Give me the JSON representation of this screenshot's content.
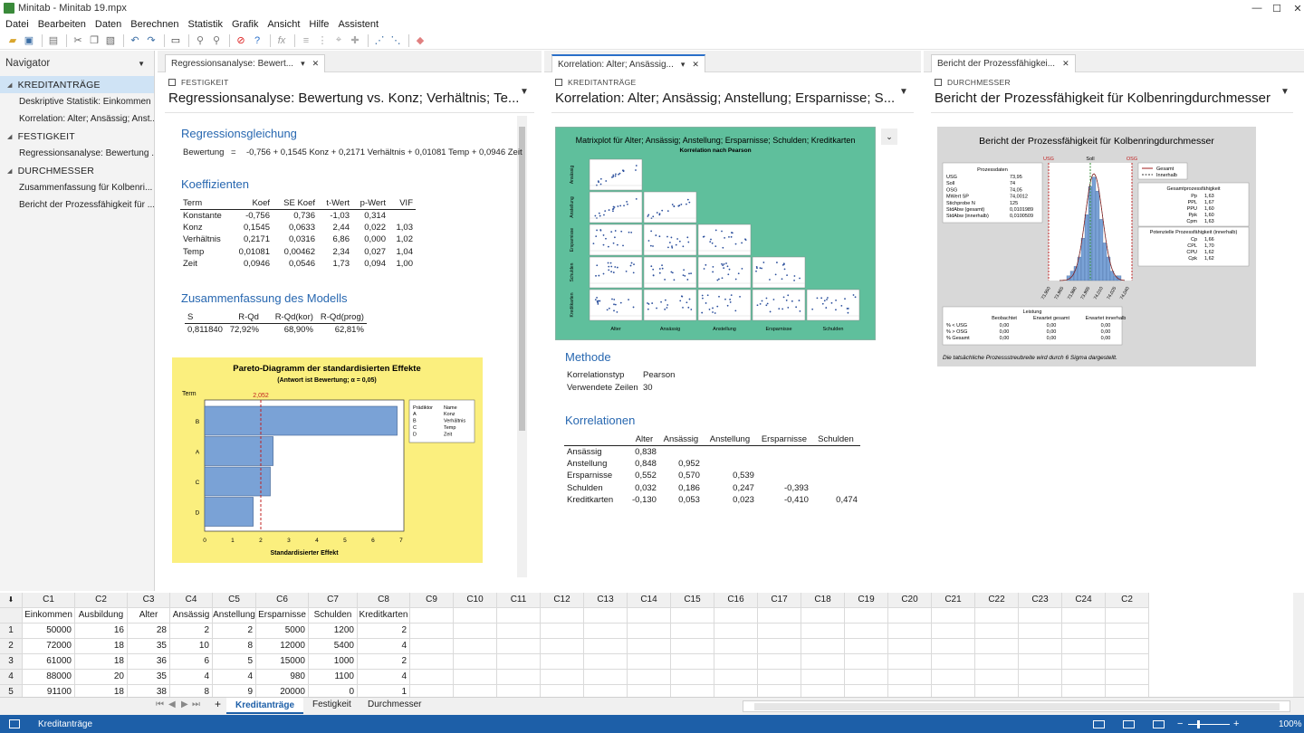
{
  "window": {
    "title": "Minitab - Minitab 19.mpx",
    "minimize": "—",
    "maximize": "☐",
    "close": "✕"
  },
  "menu": [
    "Datei",
    "Bearbeiten",
    "Daten",
    "Berechnen",
    "Statistik",
    "Grafik",
    "Ansicht",
    "Hilfe",
    "Assistent"
  ],
  "navigator": {
    "title": "Navigator",
    "groups": [
      {
        "label": "KREDITANTRÄGE",
        "items": [
          "Deskriptive Statistik: Einkommen",
          "Korrelation: Alter; Ansässig; Anst..."
        ]
      },
      {
        "label": "FESTIGKEIT",
        "items": [
          "Regressionsanalyse: Bewertung ..."
        ]
      },
      {
        "label": "DURCHMESSER",
        "items": [
          "Zusammenfassung für Kolbenri...",
          "Bericht der Prozessfähigkeit für ..."
        ]
      }
    ]
  },
  "pane1": {
    "tab": "Regressionsanalyse: Bewert...",
    "section": "FESTIGKEIT",
    "title": "Regressionsanalyse: Bewertung vs. Konz; Verhältnis; Te...",
    "h_equation": "Regressionsgleichung",
    "eq_lhs": "Bewertung",
    "eq_sign": "=",
    "eq_rhs": "-0,756 + 0,1545 Konz + 0,2171 Verhältnis + 0,01081 Temp + 0,0946 Zeit",
    "h_coef": "Koeffizienten",
    "coef_headers": [
      "Term",
      "Koef",
      "SE Koef",
      "t-Wert",
      "p-Wert",
      "VIF"
    ],
    "coef_rows": [
      [
        "Konstante",
        "-0,756",
        "0,736",
        "-1,03",
        "0,314",
        ""
      ],
      [
        "Konz",
        "0,1545",
        "0,0633",
        "2,44",
        "0,022",
        "1,03"
      ],
      [
        "Verhältnis",
        "0,2171",
        "0,0316",
        "6,86",
        "0,000",
        "1,02"
      ],
      [
        "Temp",
        "0,01081",
        "0,00462",
        "2,34",
        "0,027",
        "1,04"
      ],
      [
        "Zeit",
        "0,0946",
        "0,0546",
        "1,73",
        "0,094",
        "1,00"
      ]
    ],
    "h_model": "Zusammenfassung des Modells",
    "model_headers": [
      "S",
      "R-Qd",
      "R-Qd(kor)",
      "R-Qd(prog)"
    ],
    "model_row": [
      "0,811840",
      "72,92%",
      "68,90%",
      "62,81%"
    ],
    "pareto": {
      "title": "Pareto-Diagramm der standardisierten Effekte",
      "subtitle": "(Antwort ist Bewertung; α = 0,05)",
      "yaxis_label": "Term",
      "ref_label": "2,052",
      "xlabel": "Standardisierter Effekt",
      "legend_headers": [
        "Prädiktor",
        "Name"
      ],
      "legend": [
        [
          "A",
          "Konz"
        ],
        [
          "B",
          "Verhältnis"
        ],
        [
          "C",
          "Temp"
        ],
        [
          "D",
          "Zeit"
        ]
      ],
      "xticks": [
        "0",
        "1",
        "2",
        "3",
        "4",
        "5",
        "6",
        "7"
      ],
      "bg_color": "#fbef7e",
      "bar_color": "#7aa2d6"
    }
  },
  "pane2": {
    "tab": "Korrelation: Alter; Ansässig...",
    "section": "KREDITANTRÄGE",
    "title": "Korrelation: Alter; Ansässig; Anstellung; Ersparnisse; S...",
    "matrix_title": "Matrixplot für Alter; Ansässig; Anstellung; Ersparnisse; Schulden; Kreditkarten",
    "matrix_subtitle": "Korrelation nach Pearson",
    "matrix_vars": [
      "Alter",
      "Ansässig",
      "Anstellung",
      "Ersparnisse",
      "Schulden",
      "Kreditkarten"
    ],
    "matrix_bg": "#5fbf9c",
    "h_method": "Methode",
    "method_rows": [
      [
        "Korrelationstyp",
        "Pearson"
      ],
      [
        "Verwendete Zeilen",
        "30"
      ]
    ],
    "h_corr": "Korrelationen",
    "corr_headers": [
      "",
      "Alter",
      "Ansässig",
      "Anstellung",
      "Ersparnisse",
      "Schulden"
    ],
    "corr_rows": [
      [
        "Ansässig",
        "0,838",
        "",
        "",
        "",
        ""
      ],
      [
        "Anstellung",
        "0,848",
        "0,952",
        "",
        "",
        ""
      ],
      [
        "Ersparnisse",
        "0,552",
        "0,570",
        "0,539",
        "",
        ""
      ],
      [
        "Schulden",
        "0,032",
        "0,186",
        "0,247",
        "-0,393",
        ""
      ],
      [
        "Kreditkarten",
        "-0,130",
        "0,053",
        "0,023",
        "-0,410",
        "0,474"
      ]
    ]
  },
  "pane3": {
    "tab": "Bericht der Prozessfähigkei...",
    "section": "DURCHMESSER",
    "title": "Bericht der Prozessfähigkeit für Kolbenringdurchmesser",
    "report_title": "Bericht der Prozessfähigkeit für Kolbenringdurchmesser",
    "proc_title": "Prozessdaten",
    "proc_rows": [
      [
        "USG",
        "73,95"
      ],
      [
        "Soll",
        "74"
      ],
      [
        "OSG",
        "74,05"
      ],
      [
        "MWert SP",
        "74,0012"
      ],
      [
        "Stichprobe N",
        "125"
      ],
      [
        "StdAbw (gesamt)",
        "0,0101989"
      ],
      [
        "StdAbw (innerhalb)",
        "0,0100509"
      ]
    ],
    "spec_labels": [
      "USG",
      "Soll",
      "OSG"
    ],
    "legend": [
      "Gesamt",
      "Innerhalb"
    ],
    "overall_title": "Gesamtprozessfähigkeit",
    "overall_rows": [
      [
        "Pp",
        "1,63"
      ],
      [
        "PPL",
        "1,67"
      ],
      [
        "PPU",
        "1,60"
      ],
      [
        "Ppk",
        "1,60"
      ],
      [
        "Cpm",
        "1,63"
      ]
    ],
    "potential_title": "Potenzielle Prozessfähigkeit (innerhalb)",
    "potential_rows": [
      [
        "Cp",
        "1,66"
      ],
      [
        "CPL",
        "1,70"
      ],
      [
        "CPU",
        "1,62"
      ],
      [
        "Cpk",
        "1,62"
      ]
    ],
    "xticks": [
      "73,950",
      "73,965",
      "73,980",
      "73,995",
      "74,010",
      "74,025",
      "74,040"
    ],
    "perf_title": "Leistung",
    "perf_headers": [
      "",
      "Beobachtet",
      "Erwartet gesamt",
      "Erwartet innerhalb"
    ],
    "perf_rows": [
      [
        "% < USG",
        "0,00",
        "0,00",
        "0,00"
      ],
      [
        "% > OSG",
        "0,00",
        "0,00",
        "0,00"
      ],
      [
        "% Gesamt",
        "0,00",
        "0,00",
        "0,00"
      ]
    ],
    "note": "Die tatsächliche Prozessstreubreite wird durch 6 Sigma dargestellt."
  },
  "worksheet": {
    "col_ids": [
      "C1",
      "C2",
      "C3",
      "C4",
      "C5",
      "C6",
      "C7",
      "C8",
      "C9",
      "C10",
      "C11",
      "C12",
      "C13",
      "C14",
      "C15",
      "C16",
      "C17",
      "C18",
      "C19",
      "C20",
      "C21",
      "C22",
      "C23",
      "C24",
      "C2"
    ],
    "col_names": [
      "Einkommen",
      "Ausbildung",
      "Alter",
      "Ansässig",
      "Anstellung",
      "Ersparnisse",
      "Schulden",
      "Kreditkarten"
    ],
    "rows": [
      [
        "50000",
        "16",
        "28",
        "2",
        "2",
        "5000",
        "1200",
        "2"
      ],
      [
        "72000",
        "18",
        "35",
        "10",
        "8",
        "12000",
        "5400",
        "4"
      ],
      [
        "61000",
        "18",
        "36",
        "6",
        "5",
        "15000",
        "1000",
        "2"
      ],
      [
        "88000",
        "20",
        "35",
        "4",
        "4",
        "980",
        "1100",
        "4"
      ],
      [
        "91100",
        "18",
        "38",
        "8",
        "9",
        "20000",
        "0",
        "1"
      ]
    ],
    "row_numbers": [
      "1",
      "2",
      "3",
      "4",
      "5"
    ]
  },
  "sheets": [
    "Kreditanträge",
    "Festigkeit",
    "Durchmesser"
  ],
  "status": {
    "text": "Kreditanträge",
    "zoom": "100%"
  }
}
